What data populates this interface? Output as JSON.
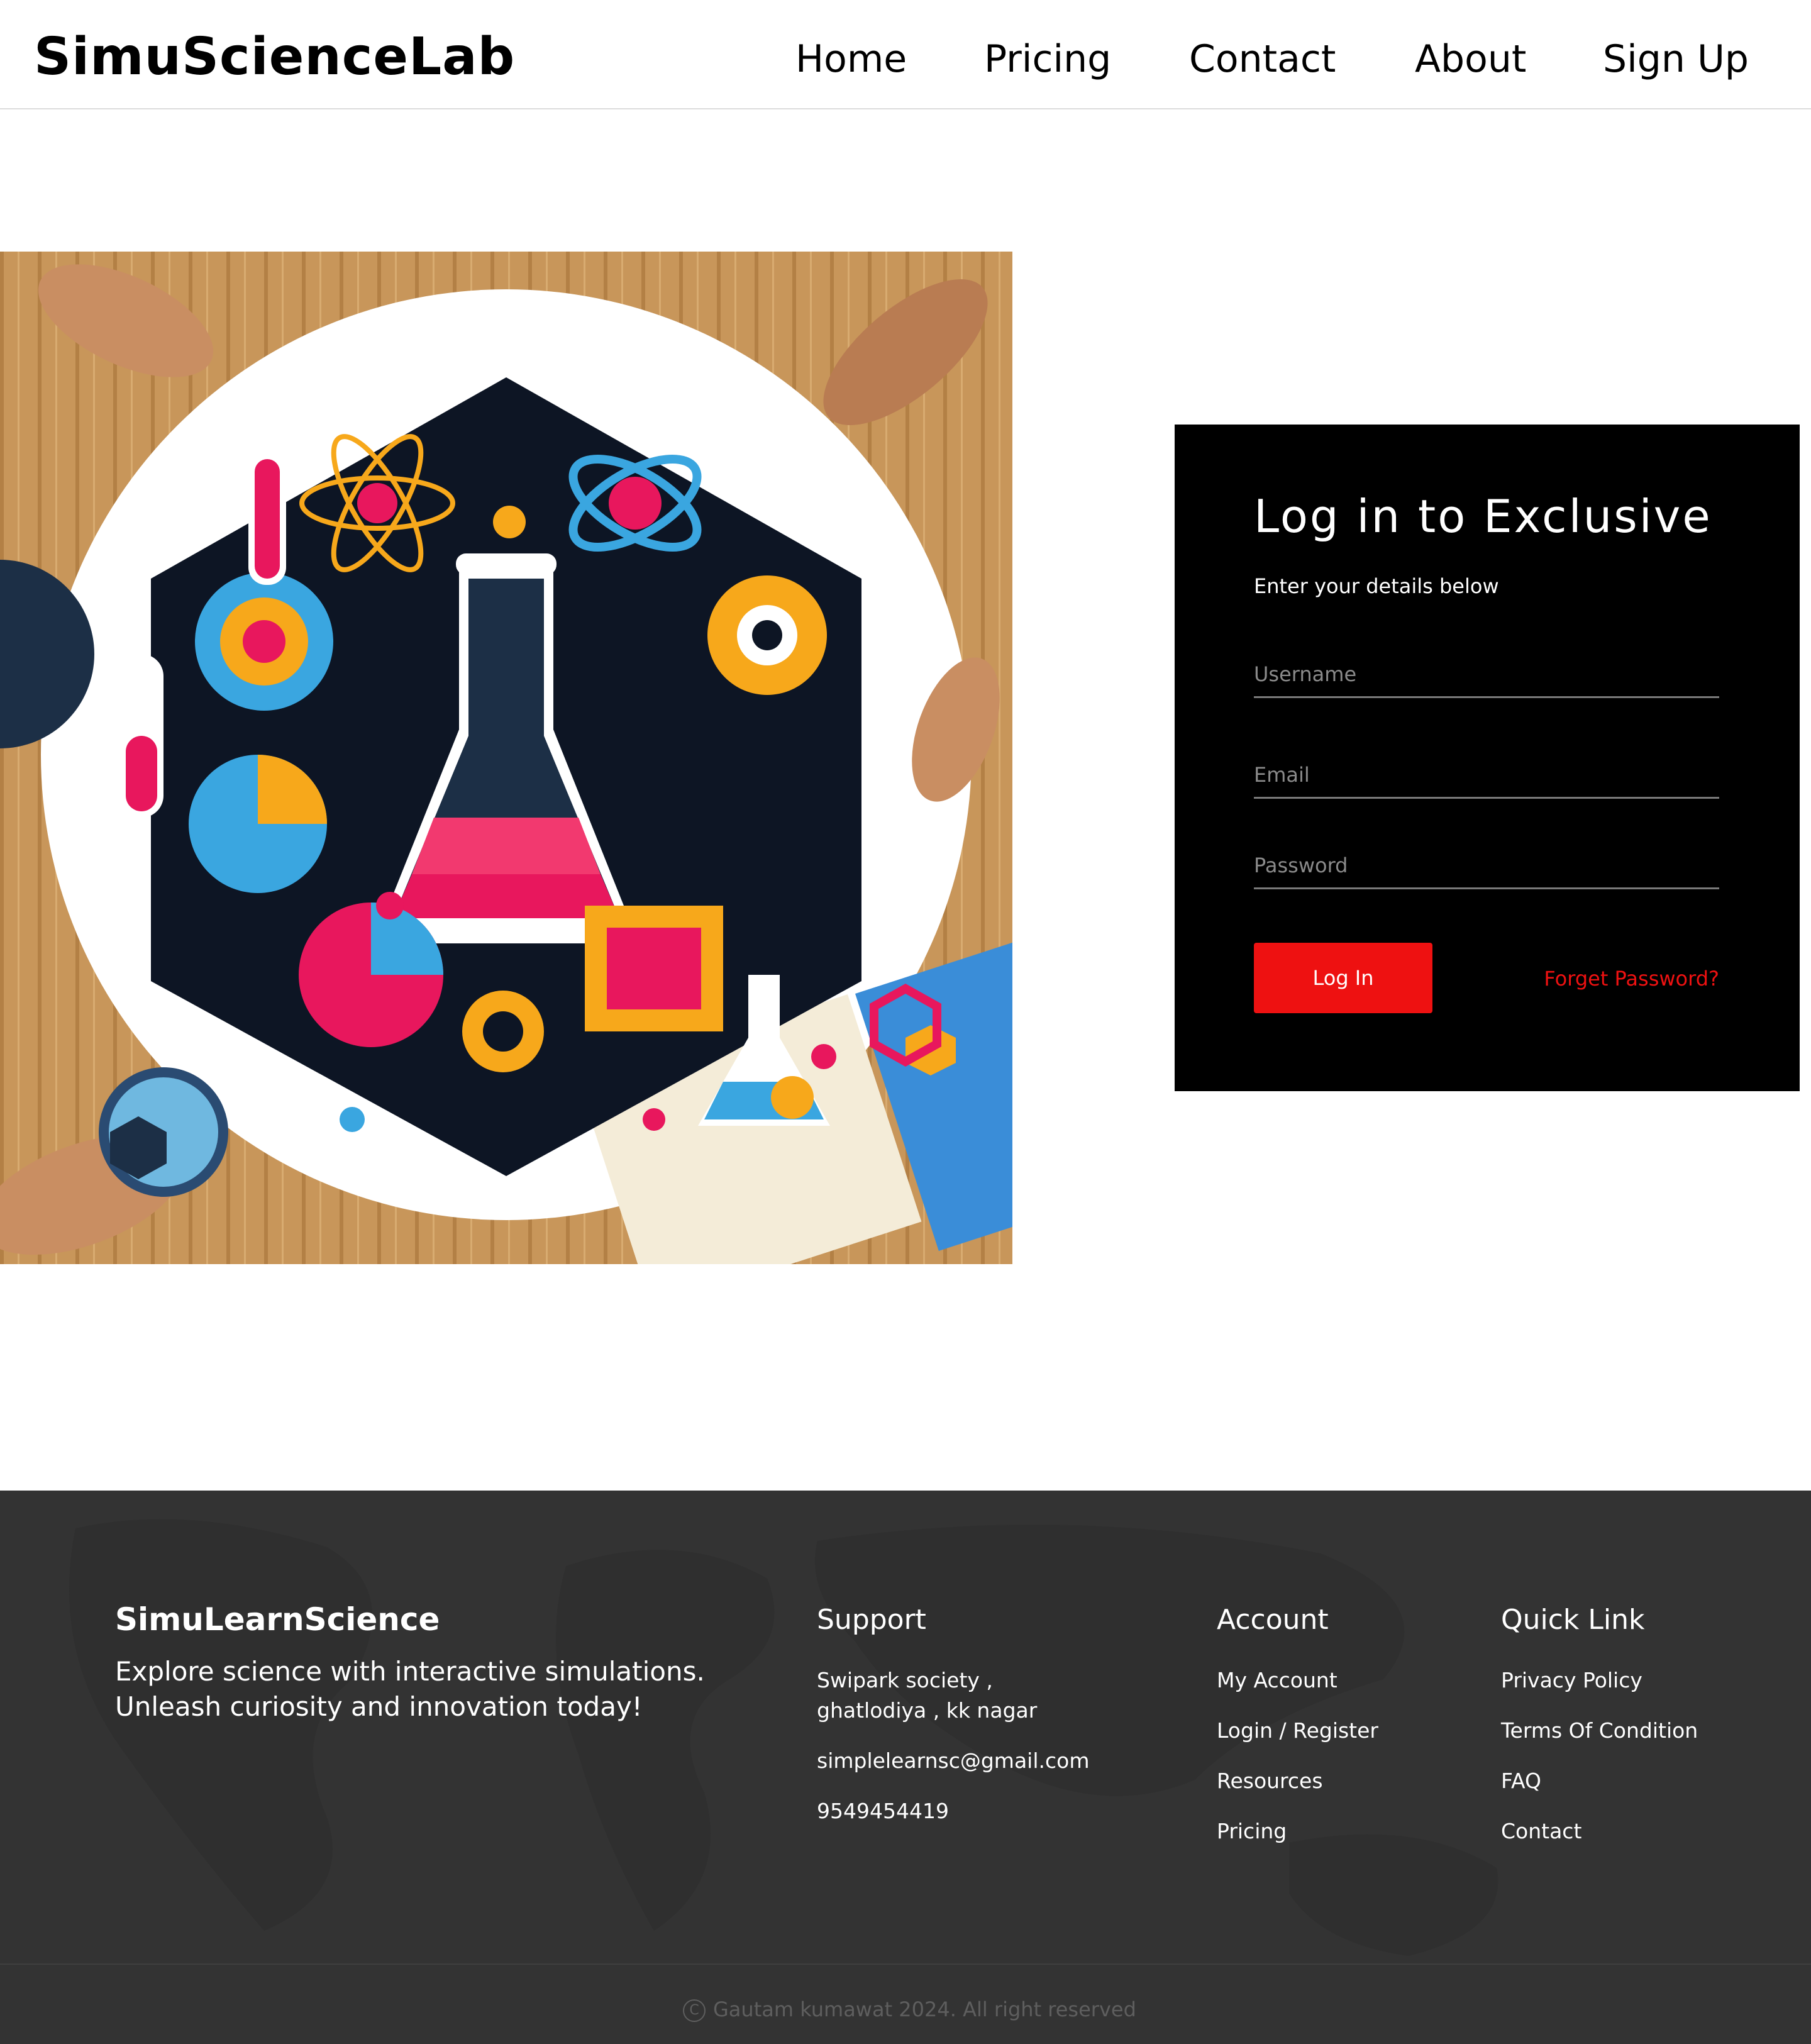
{
  "header": {
    "logo": "SimuScienceLab",
    "nav": [
      "Home",
      "Pricing",
      "Contact",
      "About",
      "Sign Up"
    ]
  },
  "hero": {
    "image_icon": "science-lab-illustration"
  },
  "login": {
    "title": "Log in to Exclusive",
    "subtitle": "Enter your details below",
    "username_placeholder": "Username",
    "email_placeholder": "Email",
    "password_placeholder": "Password",
    "login_button": "Log In",
    "forgot_link": "Forget Password?",
    "accent_color": "#ee1111"
  },
  "footer": {
    "brand": "SimuLearnScience",
    "tagline": "Explore science with interactive simulations. Unleash curiosity and innovation today!",
    "support": {
      "title": "Support",
      "items": [
        "Swipark society , ghatlodiya , kk nagar",
        "simplelearnsc@gmail.com",
        "9549454419"
      ]
    },
    "account": {
      "title": "Account",
      "items": [
        "My Account",
        "Login / Register",
        "Resources",
        "Pricing"
      ]
    },
    "quick_link": {
      "title": "Quick Link",
      "items": [
        "Privacy Policy",
        "Terms Of Condition",
        "FAQ",
        "Contact"
      ]
    },
    "copyright": "Gautam kumawat 2024. All right reserved",
    "copyright_icon": "copyright-icon"
  }
}
